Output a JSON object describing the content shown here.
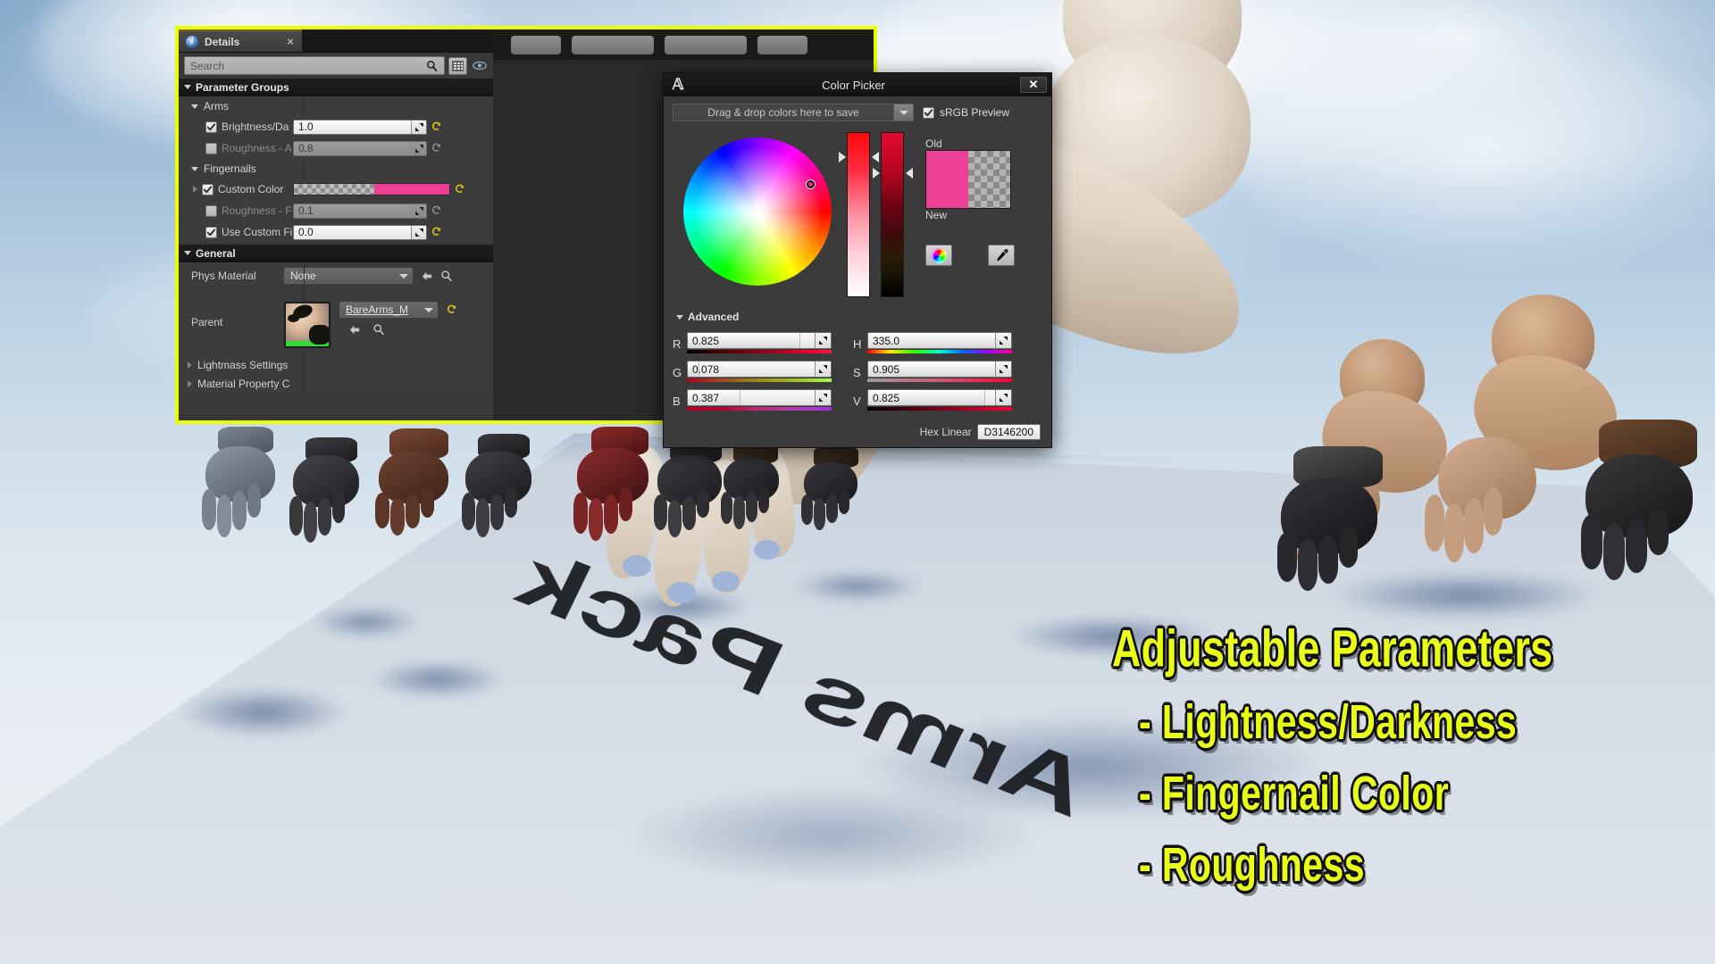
{
  "details_panel": {
    "tab": {
      "label": "Details",
      "icon": "info-icon",
      "close": "×"
    },
    "search": {
      "placeholder": "Search",
      "value": "",
      "search_icon": "magnifier-icon",
      "grid_icon": "grid-view-icon",
      "eye_icon": "eye-icon"
    },
    "groups": [
      {
        "name": "Parameter Groups",
        "type": "category"
      },
      {
        "name": "Arms",
        "type": "subcategory"
      },
      {
        "name": "Fingernails",
        "type": "subcategory"
      }
    ],
    "rows": [
      {
        "label": "Brightness/Da",
        "checked": true,
        "enabled": true,
        "value": "1.0",
        "kind": "number",
        "reset": "active"
      },
      {
        "label": "Roughness - A",
        "checked": false,
        "enabled": false,
        "value": "0.8",
        "kind": "number",
        "reset": "inactive"
      },
      {
        "label": "Custom Color",
        "checked": true,
        "enabled": true,
        "value": "",
        "kind": "color",
        "color": "#ee3f96",
        "reset": "active",
        "expandable": true
      },
      {
        "label": "Roughness - F",
        "checked": false,
        "enabled": false,
        "value": "0.1",
        "kind": "number",
        "reset": "inactive"
      },
      {
        "label": "Use Custom Fi",
        "checked": true,
        "enabled": true,
        "value": "0.0",
        "kind": "number",
        "reset": "active"
      }
    ],
    "general": {
      "title": "General",
      "phys_material": {
        "label": "Phys Material",
        "value": "None",
        "back_icon": "back-arrow-icon",
        "browse_icon": "browse-icon"
      },
      "parent": {
        "label": "Parent",
        "value": "BareArms_M",
        "back_icon": "back-arrow-icon",
        "browse_icon": "browse-icon",
        "thumbnail": "material-sphere-thumbnail"
      }
    },
    "collapsed": [
      {
        "label": "Lightmass Settings"
      },
      {
        "label": "Material Property C"
      }
    ]
  },
  "color_picker": {
    "title": "Color Picker",
    "logo": "unreal-engine-logo",
    "close_label": "✕",
    "save_bar": {
      "label": "Drag & drop colors here to save",
      "caret": "chevron-down-icon"
    },
    "srgb": {
      "label": "sRGB Preview",
      "checked": true
    },
    "old_label": "Old",
    "new_label": "New",
    "old_color": "#ee3f96",
    "new_color": "#ee3f96",
    "tools": {
      "wheel_icon": "color-wheel-icon",
      "eyedropper_icon": "eyedropper-icon"
    },
    "advanced_label": "Advanced",
    "channels_rgb": [
      {
        "name": "R",
        "value": "0.825",
        "fill_pct": 79,
        "grad": "linear-gradient(90deg,#000000,#3a0000 18%,#7a0012 42%,#c00020 68%,#ff0033 88%,#ff1a3d 100%)"
      },
      {
        "name": "G",
        "value": "0.078",
        "fill_pct": 8,
        "grad": "linear-gradient(90deg,#b80024,#a9351f 18%,#9c7a1a 42%,#9fae20 68%,#9fe03a 88%,#a6ff46 100%)"
      },
      {
        "name": "B",
        "value": "0.387",
        "fill_pct": 37,
        "grad": "linear-gradient(90deg,#b80024,#b5002f 24%,#bb2a6f 48%,#b83ba8 70%,#a93ad0 88%,#9b2ee0 100%)"
      }
    ],
    "channels_hsv": [
      {
        "name": "H",
        "value": "335.0",
        "fill_pct": 93,
        "grad": "linear-gradient(90deg,#ff0000,#ffea00 16%,#22ff00 33%,#00ffd5 50%,#0066ff 66%,#a100ff 83%,#ff0099 100%)"
      },
      {
        "name": "S",
        "value": "0.905",
        "fill_pct": 90,
        "grad": "linear-gradient(90deg,#9b9b9b,#d1536f 55%,#ff0033 100%)"
      },
      {
        "name": "V",
        "value": "0.825",
        "fill_pct": 82,
        "grad": "linear-gradient(90deg,#000000,#7a0018 50%,#ff0033 100%)"
      }
    ],
    "hex": {
      "label": "Hex Linear",
      "value": "D3146200"
    }
  },
  "annotations": {
    "title": "Adjustable Parameters",
    "items": [
      "- Lightness/Darkness",
      "- Fingernail Color",
      "- Roughness"
    ],
    "color": "#e9ff18"
  },
  "scene": {
    "floor_text": "Arms Pack",
    "description": "3D viewport showing bare arms and glove props above a white platform"
  }
}
